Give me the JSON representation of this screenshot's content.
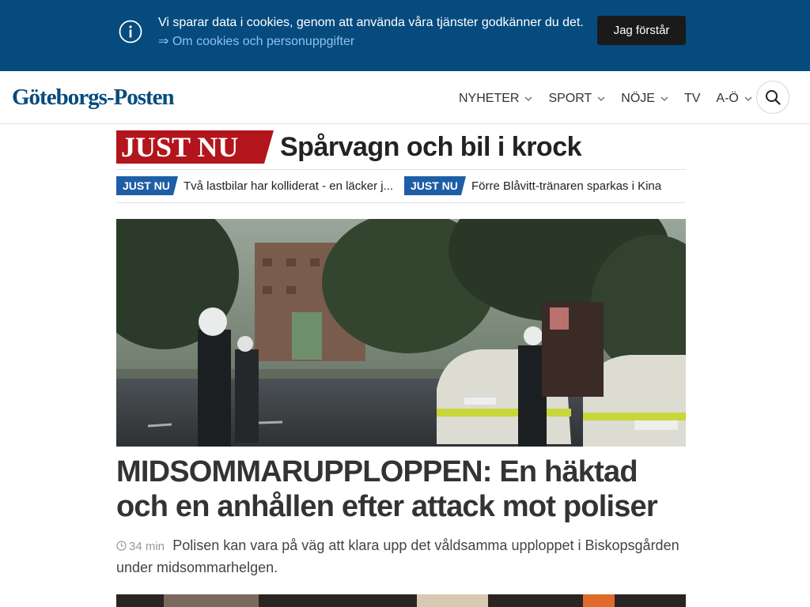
{
  "cookie": {
    "message": "Vi sparar data i cookies, genom att använda våra tjänster godkänner du det.",
    "link": "⇒ Om cookies och personuppgifter",
    "button": "Jag förstår",
    "icon": "info-icon"
  },
  "header": {
    "logo": "Göteborgs-Posten",
    "nav": [
      {
        "label": "NYHETER",
        "has_dropdown": true
      },
      {
        "label": "SPORT",
        "has_dropdown": true
      },
      {
        "label": "NÖJE",
        "has_dropdown": true
      },
      {
        "label": "TV",
        "has_dropdown": false
      },
      {
        "label": "A-Ö",
        "has_dropdown": true
      }
    ],
    "search_icon": "search-icon"
  },
  "just_nu": {
    "flag": "JUST NU",
    "headline": "Spårvagn och bil i krock",
    "items": [
      {
        "badge": "JUST NU",
        "text": "Två lastbilar har kolliderat - en läcker j..."
      },
      {
        "badge": "JUST NU",
        "text": "Förre Blåvitt-tränaren sparkas i Kina"
      }
    ]
  },
  "article": {
    "headline": "MIDSOMMARUPPLOPPEN: En häktad och en anhållen efter attack mot poliser",
    "time": "34 min",
    "clock_icon": "clock-icon",
    "lead": "Polisen kan vara på väg att klara upp det våldsamma upploppet i Biskopsgården under midsommarhelgen."
  },
  "colors": {
    "banner": "#064b7e",
    "brand": "#064b7e",
    "just_nu_red": "#b3151c",
    "just_nu_blue": "#1e5ea6"
  }
}
